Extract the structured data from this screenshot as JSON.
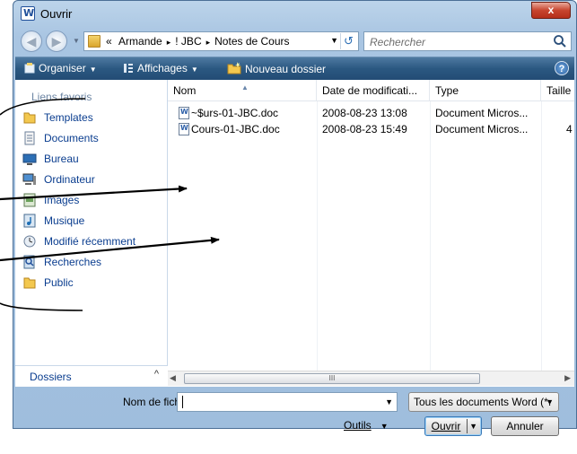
{
  "window": {
    "title": "Ouvrir",
    "close_label": "x"
  },
  "nav": {
    "back_glyph": "◀",
    "forward_glyph": "▶",
    "crumbs": [
      "«",
      "Armande",
      "! JBC",
      "Notes de Cours"
    ],
    "crumb_sep": "▸",
    "search_placeholder": "Rechercher"
  },
  "toolbar": {
    "organize": "Organiser",
    "views": "Affichages",
    "new_folder": "Nouveau dossier",
    "help": "?"
  },
  "sidebar": {
    "heading": "Liens favoris",
    "items": [
      {
        "label": "Templates",
        "icon": "folder-icon"
      },
      {
        "label": "Documents",
        "icon": "documents-icon"
      },
      {
        "label": "Bureau",
        "icon": "desktop-icon"
      },
      {
        "label": "Ordinateur",
        "icon": "computer-icon"
      },
      {
        "label": "Images",
        "icon": "pictures-icon"
      },
      {
        "label": "Musique",
        "icon": "music-icon"
      },
      {
        "label": "Modifié récemment",
        "icon": "recent-icon"
      },
      {
        "label": "Recherches",
        "icon": "searches-icon"
      },
      {
        "label": "Public",
        "icon": "folder-icon"
      }
    ],
    "folders_label": "Dossiers",
    "folders_chevron": "^"
  },
  "filelist": {
    "columns": [
      "Nom",
      "Date de modificati...",
      "Type",
      "Taille"
    ],
    "rows": [
      {
        "name": "~$urs-01-JBC.doc",
        "date": "2008-08-23 13:08",
        "type": "Document Micros...",
        "size": ""
      },
      {
        "name": "Cours-01-JBC.doc",
        "date": "2008-08-23 15:49",
        "type": "Document Micros...",
        "size": "4"
      }
    ],
    "scroll_grip": "III"
  },
  "bottom": {
    "filename_label": "Nom de fichier :",
    "filename_value": "",
    "filter_value": "Tous les documents Word (*.",
    "tools_label": "Outils",
    "open_label": "Ouvrir",
    "cancel_label": "Annuler"
  },
  "colors": {
    "toolbar": "#2b5881",
    "link": "#0a3d8f",
    "heading": "#6d86a4",
    "frame": "#a9c5e2"
  }
}
